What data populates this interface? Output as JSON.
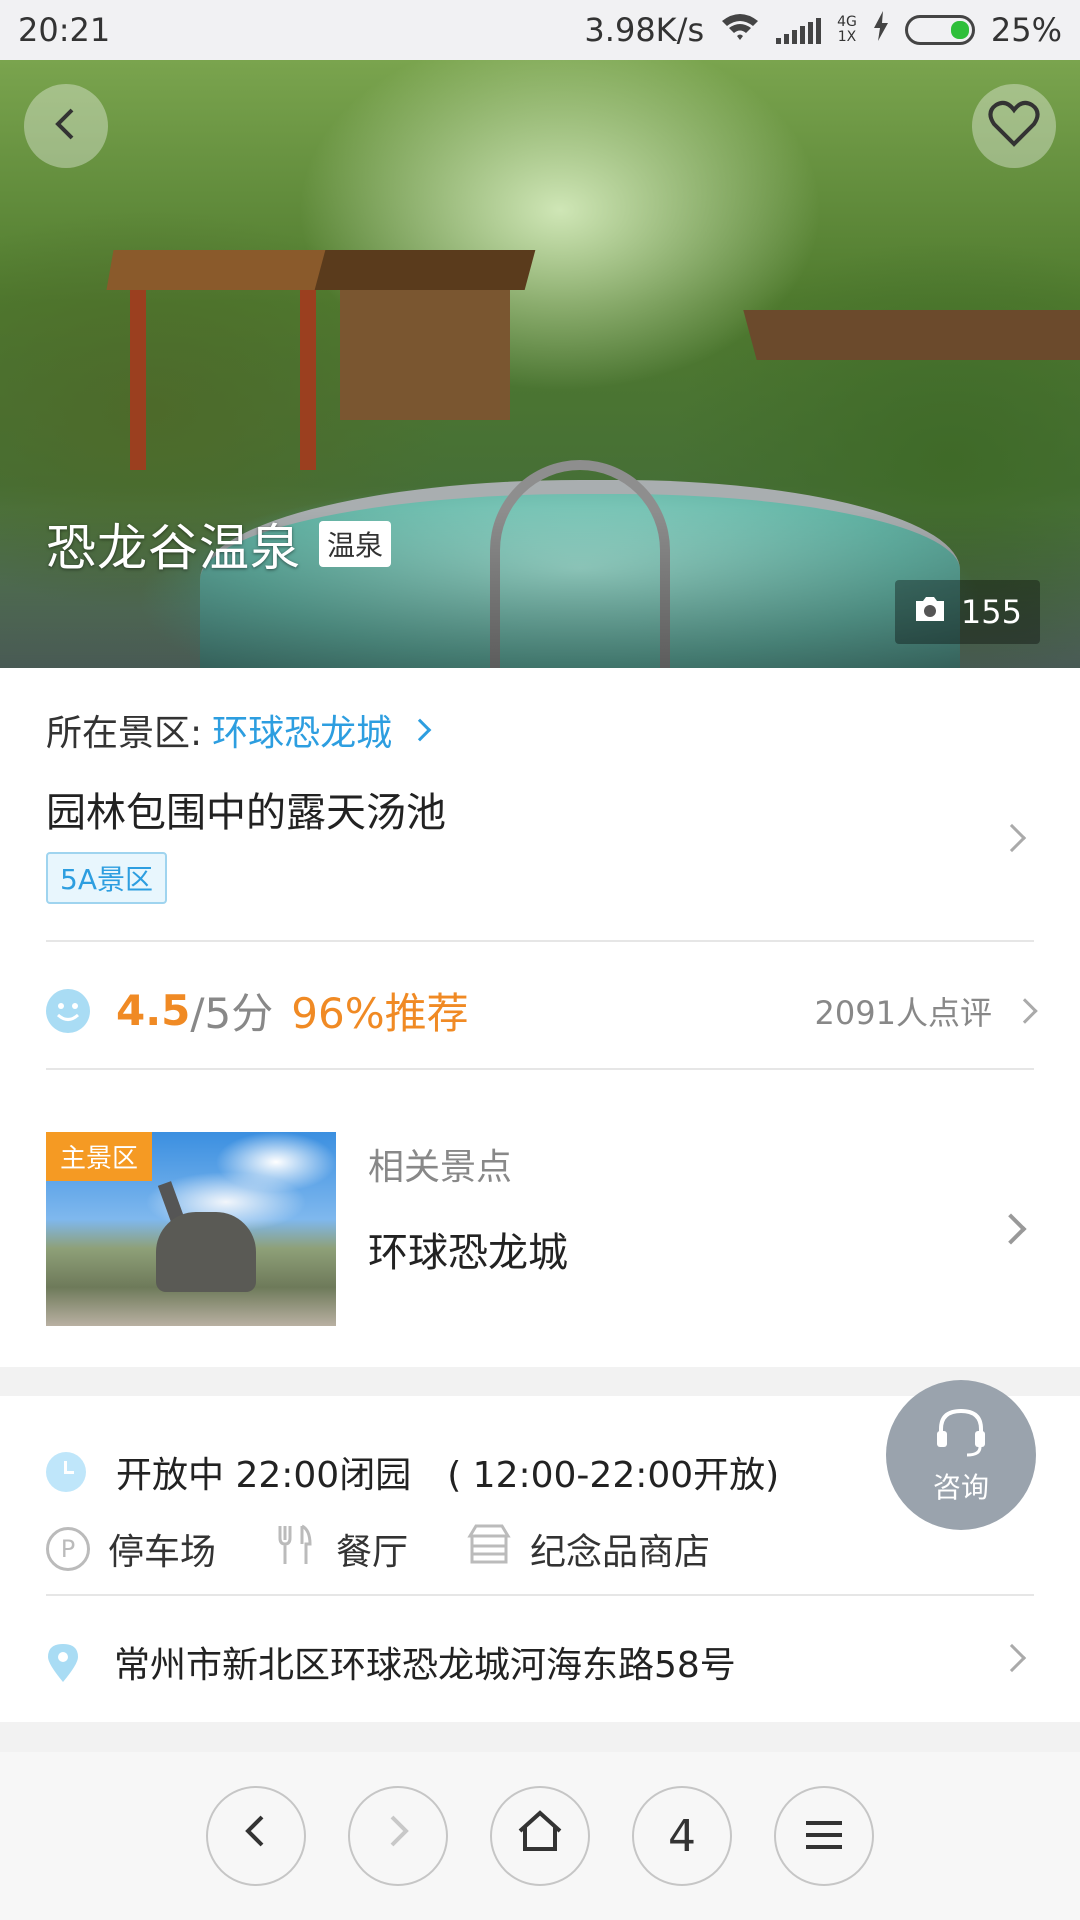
{
  "status_bar": {
    "time": "20:21",
    "speed": "3.98K/s",
    "net_top": "4G",
    "net_bottom": "1X",
    "battery": "25%"
  },
  "hero": {
    "title": "恐龙谷温泉",
    "tag": "温泉",
    "photo_count": "155"
  },
  "info": {
    "scenic_area_label": "所在景区:",
    "scenic_area_link": "环球恐龙城",
    "subtitle": "园林包围中的露天汤池",
    "grade_badge": "5A景区"
  },
  "rating": {
    "score": "4.5",
    "out_of": "/5分",
    "recommend": "96%推荐",
    "reviews": "2091人点评"
  },
  "related": {
    "image_label": "主景区",
    "caption": "相关景点",
    "name": "环球恐龙城"
  },
  "details": {
    "hours": "开放中 22:00闭园　( 12:00-22:00开放)",
    "facilities": [
      "停车场",
      "餐厅",
      "纪念品商店"
    ],
    "parking_icon_letter": "P",
    "address": "常州市新北区环球恐龙城河海东路58号"
  },
  "consult": {
    "label": "咨询"
  },
  "bottom_nav": {
    "tabs_count": "4"
  },
  "colors": {
    "accent_blue": "#2d9ee0",
    "accent_orange": "#f08a24",
    "label_orange": "#f59a23"
  }
}
